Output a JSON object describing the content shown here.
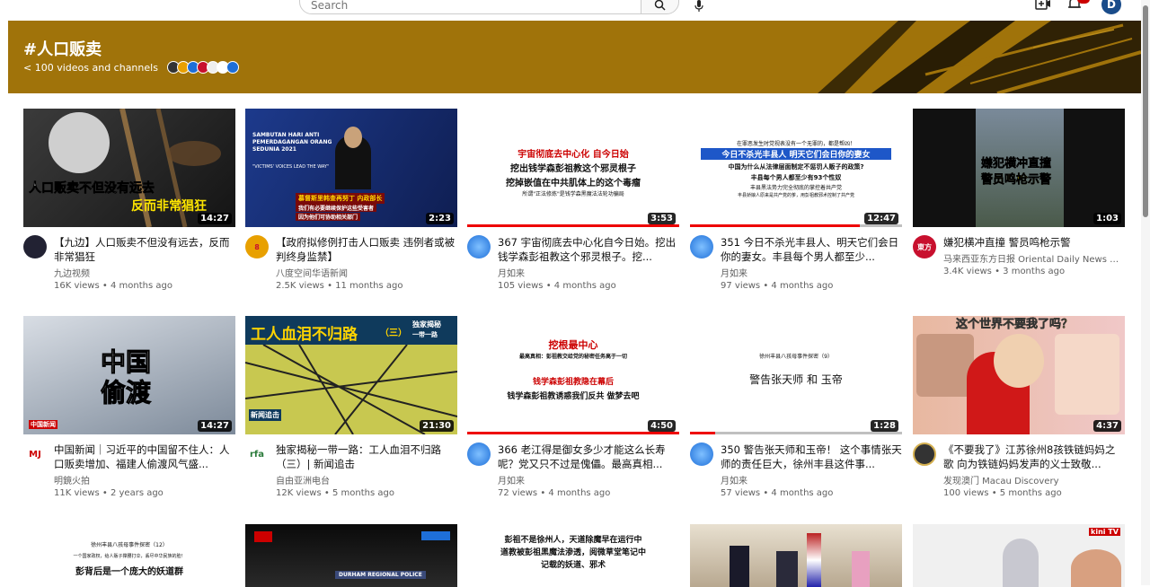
{
  "header": {
    "search_placeholder": "Search",
    "avatar_letter": "D",
    "bell_count": ""
  },
  "banner": {
    "title": "#人口贩卖",
    "subtitle": "< 100 videos and channels",
    "color": "#a0730a"
  },
  "videos": [
    {
      "title": "【九边】人口贩卖不但没有远去，反而非常猖狂",
      "channel": "九边视频",
      "views": "16K views",
      "age": "4 months ago",
      "duration": "14:27",
      "thumb_text": [
        "人口贩卖不但没有远去",
        "反而非常猖狂"
      ],
      "avatar_color": "#223",
      "avatar_text": ""
    },
    {
      "title": "【政府拟修例打击人口贩卖 违例者或被判终身监禁】",
      "channel": "八度空间华语新闻",
      "views": "2.5K views",
      "age": "11 months ago",
      "duration": "2:23",
      "thumb_text": [
        "SAMBUTAN HARI ANTI PEMERDAGANGAN ORANG SEDUNIA 2021",
        "\"VICTIMS' VOICES LEAD THE WAY\"",
        "慕督斯里韩查再努丁 内政部长",
        "我们有必要继续保护这些受害者",
        "因为他们可协助相关部门"
      ],
      "avatar_color": "#e8a000",
      "avatar_text": "8"
    },
    {
      "title": "367 宇宙彻底去中心化自今日始。挖出钱学森彭祖教这个邪灵根子。挖...",
      "channel": "月如来",
      "views": "105 views",
      "age": "4 months ago",
      "duration": "3:53",
      "thumb_text": [
        "宇宙彻底去中心化 自今日始",
        "挖出钱学森彭祖教这个邪灵根子",
        "挖掉嵌值在中共肌体上的这个毒瘤",
        "所谓\"正法修炼\"是钱学森黑魔法法轮功骗局"
      ],
      "avatar_color": "#1e6fd9",
      "avatar_text": ""
    },
    {
      "title": "351 今日不杀光丰县人、明天它们会日你的妻女。丰县每个男人都至少...",
      "channel": "月如来",
      "views": "97 views",
      "age": "4 months ago",
      "duration": "12:47",
      "thumb_text": [
        "在罪恶发生时党视表没有一个无罪的，都是帮凶！",
        "今日不杀光丰县人 明天它们会日你的妻女",
        "中国为什么从法律层面制定不惩罚人贩子的政策?",
        "丰县每个男人都至少有93个性奴",
        "丰县黑法势力完全彻底的掌控着共产党",
        "丰县娇娘人原来是共产党的爹，用彭祖教邪术控制了共产党"
      ],
      "avatar_color": "#1e6fd9",
      "avatar_text": ""
    },
    {
      "title": "嫌犯横冲直撞 警员鸣枪示警",
      "channel": "马来西亚东方日报 Oriental Daily News M...",
      "views": "3.4K views",
      "age": "3 months ago",
      "duration": "1:03",
      "thumb_text": [
        "嫌犯横冲直撞",
        "警员鸣枪示警"
      ],
      "avatar_color": "#c8102e",
      "avatar_text": "東方"
    },
    {
      "title": "中国新闻｜习近平的中国留不住人：人口贩卖增加、福建人偷渡风气盛...",
      "channel": "明鏡火拍",
      "views": "11K views",
      "age": "2 years ago",
      "duration": "14:27",
      "thumb_text": [
        "中国",
        "偷渡",
        "中国新闻"
      ],
      "avatar_color": "#fff",
      "avatar_text": "MJ"
    },
    {
      "title": "独家揭秘一带一路：工人血泪不归路（三）| 新闻追击",
      "channel": "自由亚洲电台",
      "views": "12K views",
      "age": "5 months ago",
      "duration": "21:30",
      "thumb_text": [
        "工人血泪不归路",
        "（三）",
        "独家揭秘",
        "一带一路",
        "新闻追击"
      ],
      "avatar_color": "#fff",
      "avatar_text": "rfa"
    },
    {
      "title": "366 老江得是御女多少才能这么长寿呢？党又只不过是傀儡。最高真相...",
      "channel": "月如来",
      "views": "72 views",
      "age": "4 months ago",
      "duration": "4:50",
      "thumb_text": [
        "挖根最中心",
        "最高真相：彭祖教交给党的秘密任务高于一切",
        "钱学森彭祖教隐在幕后",
        "钱学森彭祖教诱惑我们反共 做梦去吧"
      ],
      "avatar_color": "#1e6fd9",
      "avatar_text": ""
    },
    {
      "title": "350 警告张天师和玉帝！ 这个事情张天师的责任巨大，徐州丰县这件事...",
      "channel": "月如来",
      "views": "57 views",
      "age": "4 months ago",
      "duration": "1:28",
      "thumb_text": [
        "徐州丰县八孩母事件探密（9）",
        "警告张天师 和 玉帝"
      ],
      "avatar_color": "#1e6fd9",
      "avatar_text": ""
    },
    {
      "title": "《不要我了》江苏徐州8孩铁链妈妈之歌 向为铁链妈妈发声的义士致敬...",
      "channel": "发现澳门 Macau Discovery",
      "views": "100 views",
      "age": "5 months ago",
      "duration": "4:37",
      "thumb_text": [
        "这个世界不要我了吗？"
      ],
      "avatar_color": "#333",
      "avatar_text": ""
    },
    {
      "title": "",
      "channel": "",
      "views": "",
      "age": "",
      "duration": "",
      "thumb_text": [
        "徐州丰县八孩母事件探密（12）",
        "一个国家政权，给人贩子撑腰打伞，丢尽中华民族的脸！",
        "彭背后是一个庞大的妖道群"
      ],
      "avatar_color": "#fff",
      "avatar_text": ""
    },
    {
      "title": "",
      "channel": "",
      "views": "",
      "age": "",
      "duration": "",
      "thumb_text": [
        "DURHAM REGIONAL POLICE"
      ],
      "avatar_color": "#fff",
      "avatar_text": ""
    },
    {
      "title": "",
      "channel": "",
      "views": "",
      "age": "",
      "duration": "",
      "thumb_text": [
        "彭祖不是徐州人，天道除魔早在运行中",
        "道教被彭祖黑魔法渗透，阅微草堂笔记中",
        "记载的妖道、邪术"
      ],
      "avatar_color": "#fff",
      "avatar_text": ""
    },
    {
      "title": "",
      "channel": "",
      "views": "",
      "age": "",
      "duration": "",
      "thumb_text": [],
      "avatar_color": "#fff",
      "avatar_text": ""
    },
    {
      "title": "",
      "channel": "",
      "views": "",
      "age": "",
      "duration": "",
      "thumb_text": [
        "kini TV"
      ],
      "avatar_color": "#fff",
      "avatar_text": ""
    }
  ]
}
